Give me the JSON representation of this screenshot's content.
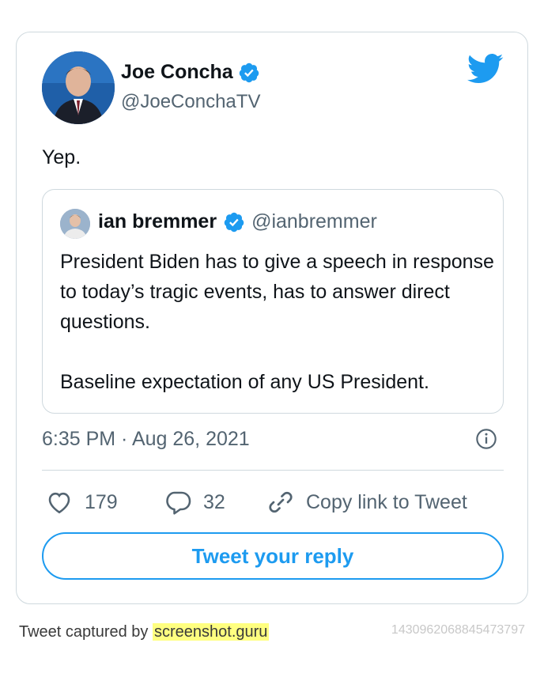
{
  "tweet": {
    "author_name": "Joe Concha",
    "author_handle": "@JoeConchaTV",
    "text": "Yep.",
    "timestamp": "6:35 PM · Aug 26, 2021"
  },
  "quoted": {
    "author_name": "ian bremmer",
    "author_handle": "@ianbremmer",
    "paragraph_1": "President Biden has to give a speech in response to today’s tragic events, has to answer direct questions.",
    "paragraph_2": "Baseline expectation of any US President."
  },
  "actions": {
    "like_count": "179",
    "reply_count": "32",
    "copy_link_label": "Copy link to Tweet"
  },
  "reply_button_label": "Tweet your reply",
  "footer": {
    "captured_prefix": "Tweet captured by",
    "brand": "screenshot.guru",
    "tweet_id": "1430962068845473797"
  },
  "colors": {
    "accent": "#1d9bf0",
    "muted_text": "#536471",
    "border": "#cfd9de",
    "brand_highlight": "#ffff80"
  },
  "icons": [
    "verified-badge-icon",
    "twitter-bird-icon",
    "info-icon",
    "heart-icon",
    "reply-bubble-icon",
    "link-icon"
  ]
}
